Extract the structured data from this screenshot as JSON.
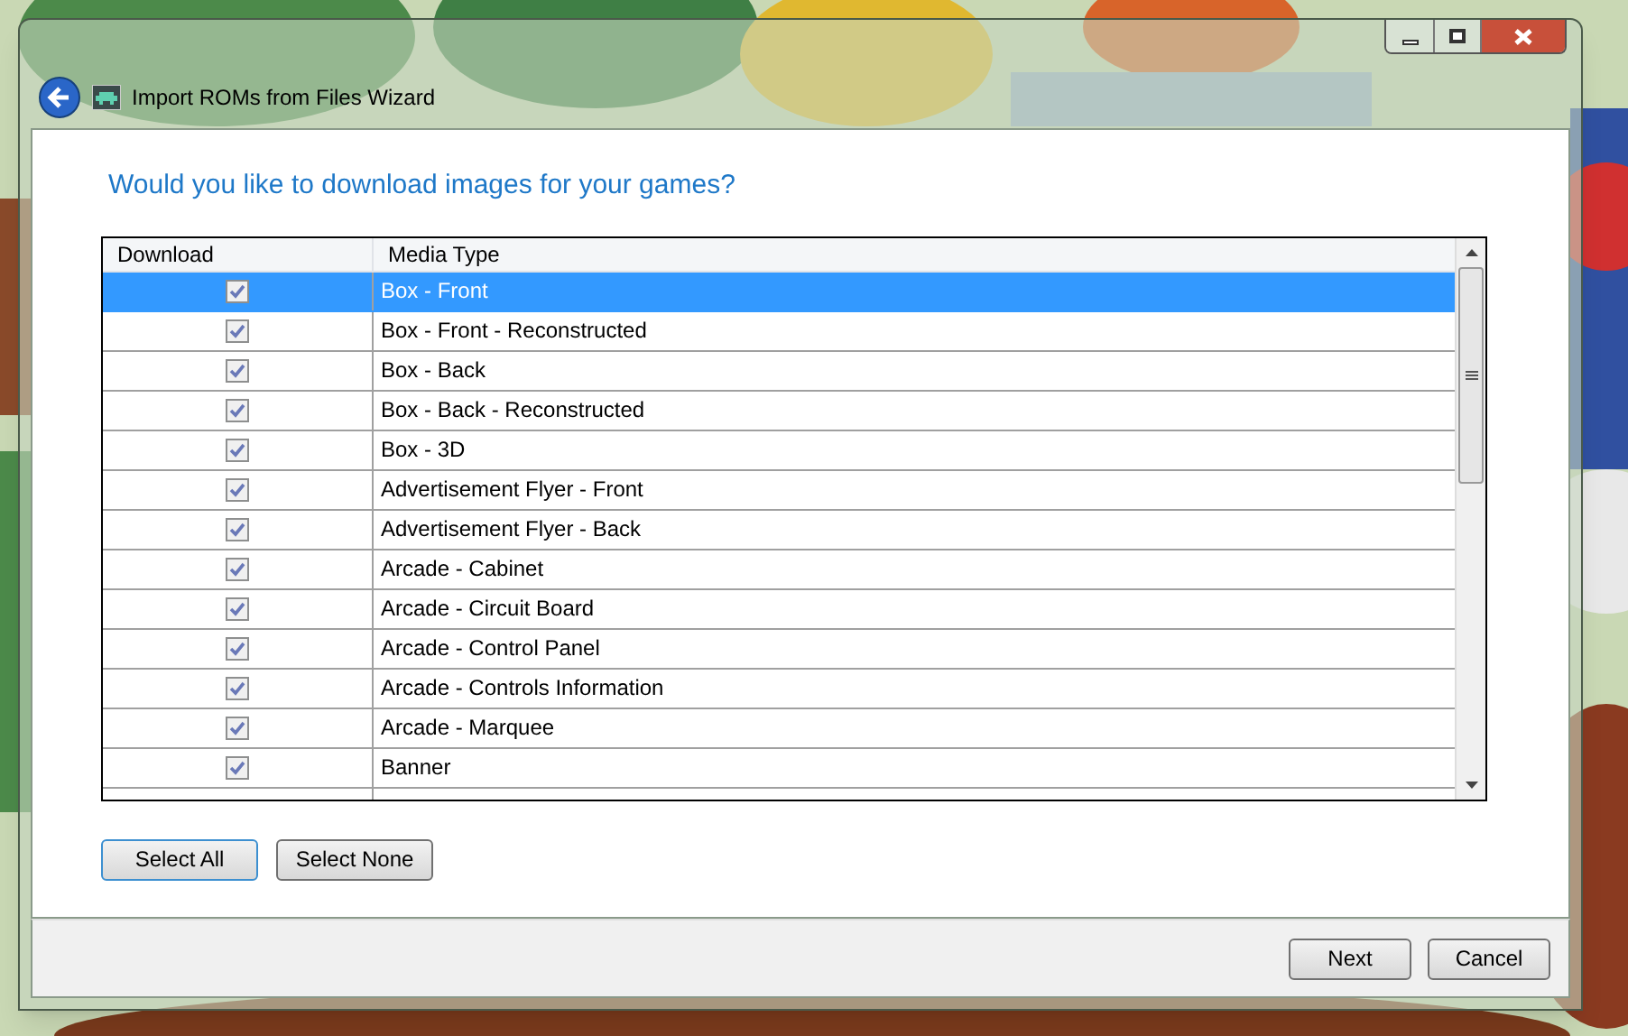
{
  "window": {
    "title": "Import ROMs from Files Wizard"
  },
  "heading": "Would you like to download images for your games?",
  "table": {
    "columns": [
      "Download",
      "Media Type"
    ],
    "rows": [
      {
        "media_type": "Box - Front",
        "checked": true,
        "selected": true
      },
      {
        "media_type": "Box - Front - Reconstructed",
        "checked": true,
        "selected": false
      },
      {
        "media_type": "Box - Back",
        "checked": true,
        "selected": false
      },
      {
        "media_type": "Box - Back - Reconstructed",
        "checked": true,
        "selected": false
      },
      {
        "media_type": "Box - 3D",
        "checked": true,
        "selected": false
      },
      {
        "media_type": "Advertisement Flyer - Front",
        "checked": true,
        "selected": false
      },
      {
        "media_type": "Advertisement Flyer - Back",
        "checked": true,
        "selected": false
      },
      {
        "media_type": "Arcade - Cabinet",
        "checked": true,
        "selected": false
      },
      {
        "media_type": "Arcade - Circuit Board",
        "checked": true,
        "selected": false
      },
      {
        "media_type": "Arcade - Control Panel",
        "checked": true,
        "selected": false
      },
      {
        "media_type": "Arcade - Controls Information",
        "checked": true,
        "selected": false
      },
      {
        "media_type": "Arcade - Marquee",
        "checked": true,
        "selected": false
      },
      {
        "media_type": "Banner",
        "checked": true,
        "selected": false
      }
    ]
  },
  "selection_buttons": [
    {
      "label": "Select All",
      "focused": true
    },
    {
      "label": "Select None",
      "focused": false
    }
  ],
  "footer_buttons": [
    "Next",
    "Cancel"
  ]
}
